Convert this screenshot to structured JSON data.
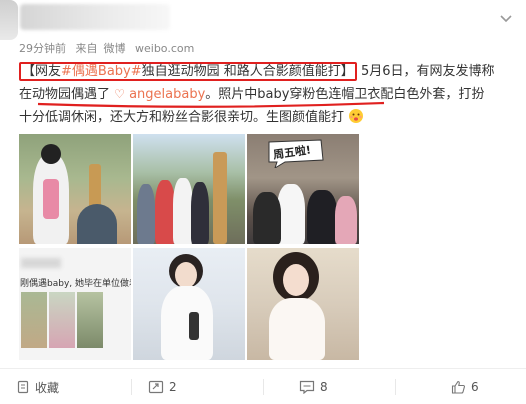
{
  "meta": {
    "time": "29分钟前",
    "via": "来自",
    "client": "微博",
    "domain": "weibo.com"
  },
  "post": {
    "prefix": "网友",
    "topic": "#偶遇Baby#",
    "headline_rest": "独自逛动物园 和路人合影颜值能打",
    "line1_tail": "5月6日，有网友发博称",
    "line2_lead": "在动物园偶遇了",
    "mention": "angelababy",
    "line2_tail": "。照片中baby穿粉色连帽卫衣配白色外套，打扮",
    "line3": "十分低调休闲，还大方和粉丝合影很亲切。生图颜值能打"
  },
  "photos": {
    "speech_bubble": "周五啦!",
    "screenshot_text": "刚偶遇baby, 她毕在单位做着撒"
  },
  "actions": {
    "favorite_label": "收藏",
    "repost_count": "2",
    "comment_count": "8",
    "like_count": "6"
  },
  "colors": {
    "highlight_box": "#e0201f",
    "link": "#eb7350"
  },
  "icons": [
    "chevron-down-icon",
    "at-mention-icon",
    "emoji-icon",
    "favorite-icon",
    "repost-icon",
    "comment-icon",
    "like-icon"
  ]
}
